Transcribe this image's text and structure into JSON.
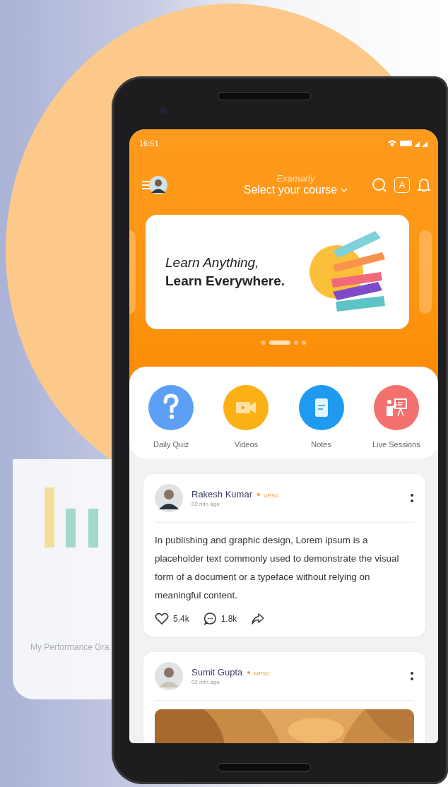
{
  "status_bar": {
    "time": "16:51"
  },
  "header": {
    "app_name": "Examarly",
    "course_selector": "Select your course",
    "language_badge": "A"
  },
  "banner": {
    "line_1": "Learn Anything,",
    "line_2": "Learn Everywhere."
  },
  "carousel_dots": [
    {
      "selected": false
    },
    {
      "selected": true
    },
    {
      "selected": false
    },
    {
      "selected": false
    }
  ],
  "categories": [
    {
      "label": "Daily Quiz",
      "kind": "quiz",
      "color": "#5e9ff6"
    },
    {
      "label": "Videos",
      "kind": "video",
      "color": "#fbb116"
    },
    {
      "label": "Notes",
      "kind": "notes",
      "color": "#1e9bf0"
    },
    {
      "label": "Live Sessions",
      "kind": "live",
      "color": "#f4706e"
    }
  ],
  "posts": [
    {
      "kind": "text",
      "author": "Rakesh Kumar",
      "exam": "UPSC",
      "time": "02 min ago",
      "text": "In publishing and graphic design, Lorem ipsum is a placeholder text commonly used to demonstrate the visual form of a document or a typeface without relying on meaningful content.",
      "likes": "5.4k",
      "comments": "1.8k"
    },
    {
      "kind": "picture",
      "author": "Sumit Gupta",
      "exam": "MPSC",
      "time": "02 min ago"
    }
  ],
  "background_phone": {
    "title": "My Performance Gra"
  }
}
